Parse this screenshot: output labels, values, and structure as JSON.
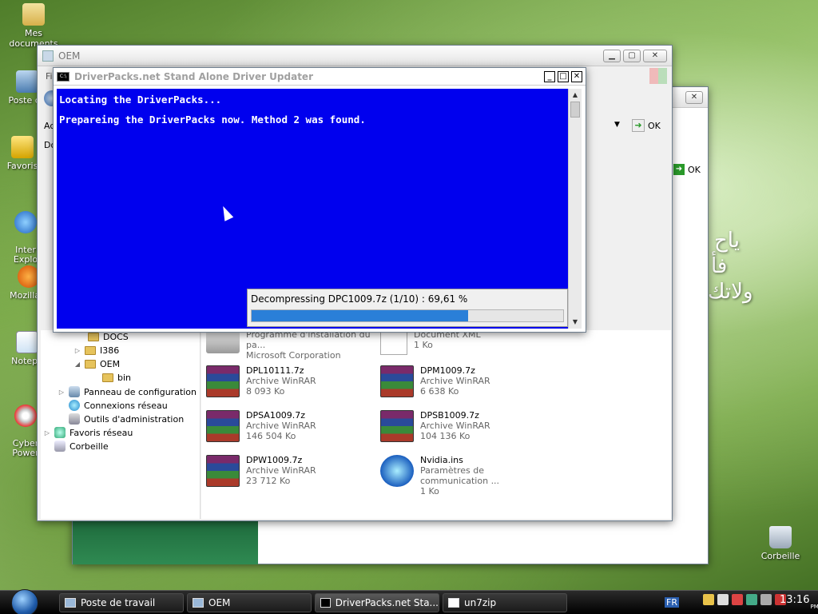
{
  "desktop": {
    "icons": [
      {
        "label": "Mes documents"
      },
      {
        "label": "Poste de"
      },
      {
        "label": "Favoris"
      },
      {
        "label": "Inter\nExplo"
      },
      {
        "label": "Mozilla F"
      },
      {
        "label": "Notepa"
      },
      {
        "label": "Cyber\nPower"
      }
    ],
    "recycle_label": "Corbeille",
    "arabic_line1": "یاح",
    "arabic_line2": "فأ",
    "arabic_line3": "ولاتك"
  },
  "explorer": {
    "title": "OEM",
    "toolbar_fragments": [
      "Fi",
      "Ac",
      "Do"
    ],
    "ok_label": "OK",
    "tree": [
      {
        "label": "DOCS",
        "type": "folder"
      },
      {
        "label": "I386",
        "type": "folder"
      },
      {
        "label": "OEM",
        "type": "folder"
      },
      {
        "label": "bin",
        "type": "folder"
      },
      {
        "label": "Panneau de configuration",
        "type": "control"
      },
      {
        "label": "Connexions réseau",
        "type": "network"
      },
      {
        "label": "Outils d'administration",
        "type": "tools"
      },
      {
        "label": "Favoris réseau",
        "type": "favnet"
      },
      {
        "label": "Corbeille",
        "type": "trash"
      }
    ],
    "files": [
      {
        "name": "Programme d'installation du pa...",
        "type": "Microsoft Corporation",
        "size": ""
      },
      {
        "name": "Document XML",
        "type": "1 Ko",
        "size": ""
      },
      {
        "name": "DPL10111.7z",
        "type": "Archive WinRAR",
        "size": "8 093 Ko"
      },
      {
        "name": "DPM1009.7z",
        "type": "Archive WinRAR",
        "size": "6 638 Ko"
      },
      {
        "name": "DPSA1009.7z",
        "type": "Archive WinRAR",
        "size": "146 504 Ko"
      },
      {
        "name": "DPSB1009.7z",
        "type": "Archive WinRAR",
        "size": "104 136 Ko"
      },
      {
        "name": "DPW1009.7z",
        "type": "Archive WinRAR",
        "size": "23 712 Ko"
      },
      {
        "name": "Nvidia.ins",
        "type": "Paramètres de communication ...",
        "size": "1 Ko"
      }
    ]
  },
  "back_window": {
    "ok_label": "OK"
  },
  "console": {
    "title": "DriverPacks.net Stand Alone Driver Updater",
    "line1": "Locating the DriverPacks...",
    "line2": "Prepareing the DriverPacks now. Method 2 was found.",
    "progress_text": "Decompressing DPC1009.7z  (1/10) : 69,61 %",
    "progress_fraction": 0.6961
  },
  "taskbar": {
    "buttons": [
      {
        "label": "Poste de travail"
      },
      {
        "label": "OEM"
      },
      {
        "label": "DriverPacks.net Sta..."
      },
      {
        "label": "un7zip"
      }
    ],
    "lang": "FR",
    "clock_time": "13:16",
    "clock_ampm": "PM"
  },
  "colors": {
    "console_bg": "#0000ee",
    "progress_fill": "#2a7fd8"
  }
}
